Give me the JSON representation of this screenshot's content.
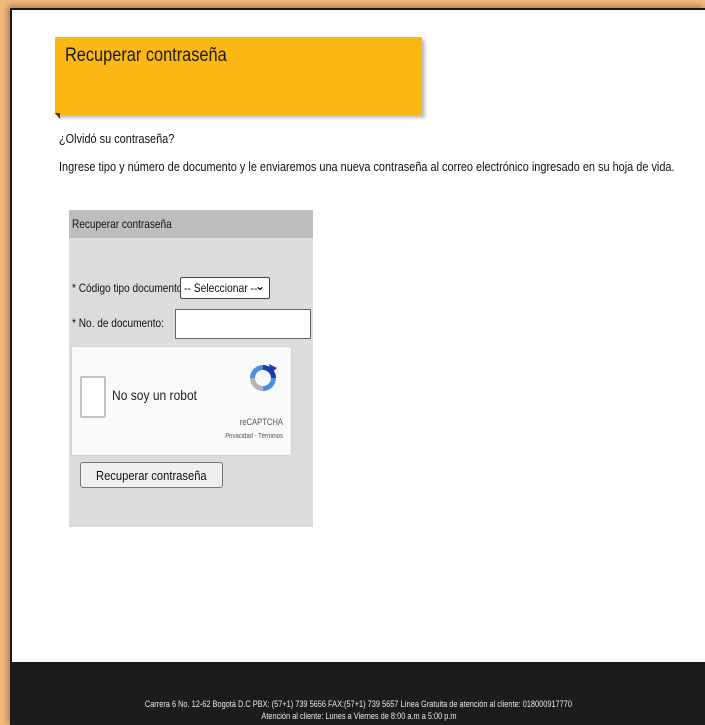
{
  "page": {
    "title": "Recuperar contraseña",
    "question": "¿Olvidó su contraseña?",
    "description": "Ingrese tipo y número de documento y le enviaremos una nueva contraseña al correo electrónico ingresado en su hoja de vida."
  },
  "form": {
    "panel_title": "Recuperar contraseña",
    "doc_type_label": "* Código tipo documento:",
    "doc_type_selected": "-- Seleccionar --",
    "doc_number_label": "* No. de documento:",
    "doc_number_value": "",
    "submit_label": "Recuperar contraseña"
  },
  "captcha": {
    "label": "No soy un robot",
    "brand": "reCAPTCHA",
    "links": "Privacidad - Términos"
  },
  "footer": {
    "line1": "Carrera 6 No. 12-62 Bogotá D.C PBX: (57+1) 739 5656 FAX:(57+1) 739 5657 Línea Gratuita de atención al cliente: 018000917770",
    "line2": "Atención al cliente: Lunes a Viernes de 8:00 a.m a 5:00 p.m"
  },
  "colors": {
    "background": "#f4b97a",
    "banner": "#fbb714",
    "panel": "#dcdcdc",
    "panel_header": "#bdbdbd",
    "footer": "#1c1c1c",
    "recaptcha_blue": "#4a90e2",
    "recaptcha_gray": "#b3b3b3"
  },
  "icons": {
    "captcha_logo": "recaptcha-logo-icon",
    "select_arrow": "chevron-down-icon"
  }
}
